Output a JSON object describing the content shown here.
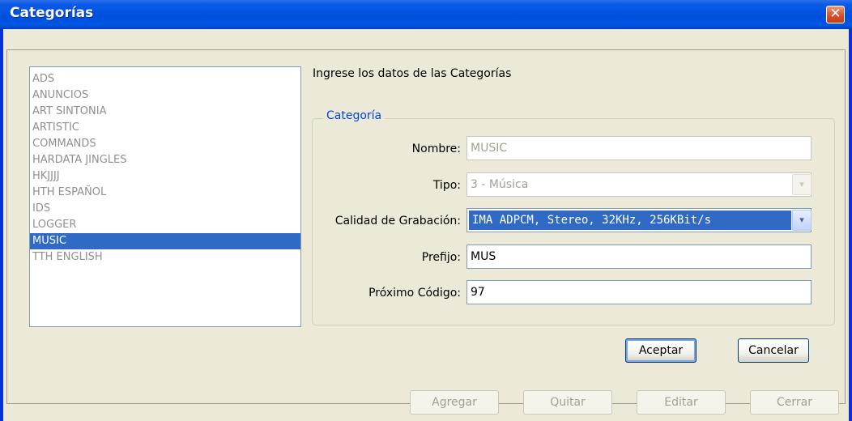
{
  "window": {
    "title": "Categorías",
    "close_glyph": "✕"
  },
  "categories": [
    "ADS",
    "ANUNCIOS",
    "ART SINTONIA",
    "ARTISTIC",
    "COMMANDS",
    "HARDATA JINGLES",
    "HKJJJJ",
    "HTH ESPAÑOL",
    "IDS",
    "LOGGER",
    "MUSIC",
    "TTH ENGLISH"
  ],
  "selected_category": "MUSIC",
  "form": {
    "intro": "Ingrese los datos de las Categorías",
    "group_title": "Categoría",
    "nombre_label": "Nombre:",
    "nombre_value": "MUSIC",
    "tipo_label": "Tipo:",
    "tipo_value": "3 - Música",
    "calidad_label": "Calidad de Grabación:",
    "calidad_value": "IMA ADPCM, Stereo, 32KHz, 256KBit/s",
    "prefijo_label": "Prefijo:",
    "prefijo_value": "MUS",
    "proximo_label": "Próximo Código:",
    "proximo_value": "97"
  },
  "buttons": {
    "aceptar": "Aceptar",
    "cancelar": "Cancelar",
    "agregar": "Agregar",
    "quitar": "Quitar",
    "editar": "Editar",
    "cerrar": "Cerrar"
  },
  "icons": {
    "dropdown_arrow": "▾",
    "dropdown_arrow_name": "chevron-down-icon"
  },
  "colors": {
    "title_bar": "#0054E3",
    "selection": "#316AC5",
    "window_bg": "#ECE9D8",
    "group_title": "#0046D5"
  }
}
